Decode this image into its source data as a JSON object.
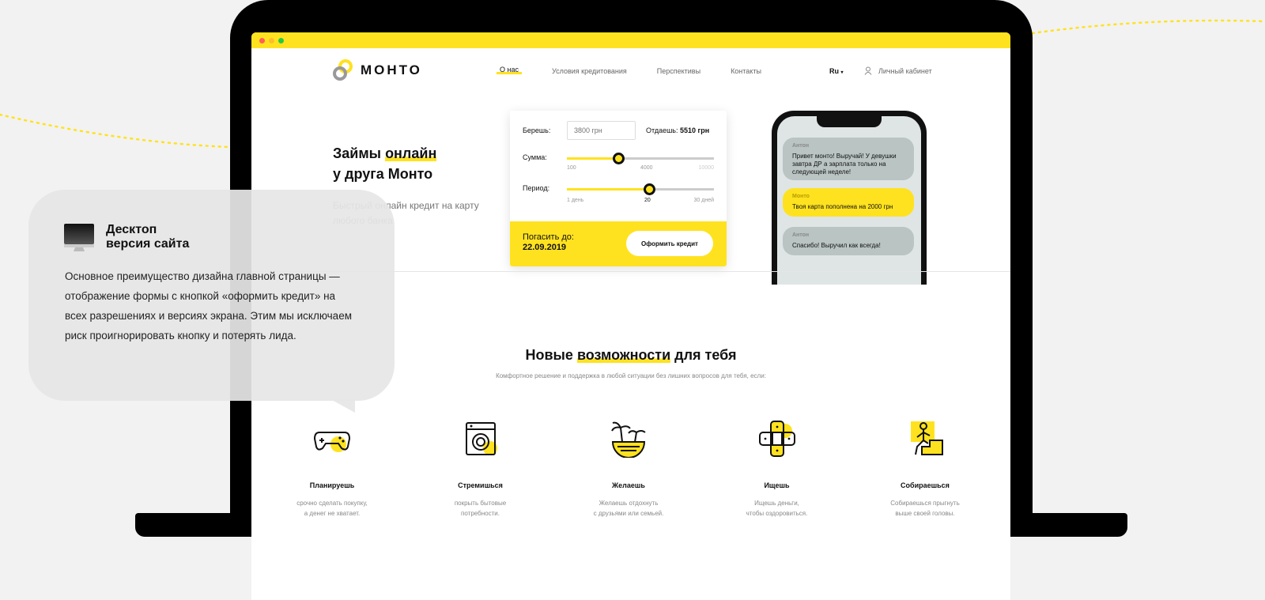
{
  "colors": {
    "accent": "#ffe21f",
    "device": "#000000",
    "bubble_gray": "#b9c4c3"
  },
  "header": {
    "logo": "МОНТО",
    "nav": [
      "О нас",
      "Условия кредитования",
      "Перспективы",
      "Контакты"
    ],
    "lang": "Ru",
    "account": "Личный кабинет"
  },
  "hero": {
    "title_1": "Займы",
    "title_hl": "онлайн",
    "title_2": "у друга Монто",
    "text": "Быстрый онлайн кредит на карту любого банка"
  },
  "calc": {
    "take_label": "Берешь:",
    "take_placeholder": "3800 грн",
    "give_label": "Отдаешь:",
    "give_value": "5510 грн",
    "sum_label": "Сумма:",
    "sum_ticks": [
      "100",
      "4000",
      "10000"
    ],
    "sum_fill": 0.35,
    "period_label": "Период:",
    "period_ticks": [
      "1 день",
      "20",
      "30 дней"
    ],
    "period_fill": 0.56,
    "pay_label": "Погасить до:",
    "pay_date": "22.09.2019",
    "button": "Оформить кредит"
  },
  "chat": [
    {
      "who": "Антон",
      "text": "Привет монто! Выручай! У девушки завтра ДР а зарплата только на следующей неделе!"
    },
    {
      "who": "Монто",
      "text": "Твоя карта пополнена на 2000 грн"
    },
    {
      "who": "Антон",
      "text": "Спасибо! Выручил как всегда!"
    }
  ],
  "section": {
    "title_1": "Новые",
    "title_hl": "возможности",
    "title_2": "для тебя",
    "subtitle": "Комфортное решение и поддержка в любой ситуации без лишних вопросов для тебя, если:"
  },
  "features": [
    {
      "icon": "gamepad-icon",
      "title": "Планируешь",
      "desc": "срочно сделать покупку,\nа денег не хватает."
    },
    {
      "icon": "washing-machine-icon",
      "title": "Стремишься",
      "desc": "покрыть бытовые\nпотребности."
    },
    {
      "icon": "palm-island-icon",
      "title": "Желаешь",
      "desc": "Желаешь отдохнуть\nс друзьями или семьей."
    },
    {
      "icon": "bandage-icon",
      "title": "Ищешь",
      "desc": "Ищешь деньги,\nчтобы оздоровиться."
    },
    {
      "icon": "climbing-stairs-icon",
      "title": "Собираешься",
      "desc": "Собираешься прыгнуть\nвыше своей головы."
    }
  ],
  "callout": {
    "icon": "monitor-icon",
    "title_1": "Десктоп",
    "title_2": "версия сайта",
    "text": "Основное преимущество дизайна главной страницы — отображение формы с кнопкой «оформить кредит» на всех разрешениях и версиях экрана. Этим мы исключаем риск проигнорировать кнопку и потерять лида."
  }
}
